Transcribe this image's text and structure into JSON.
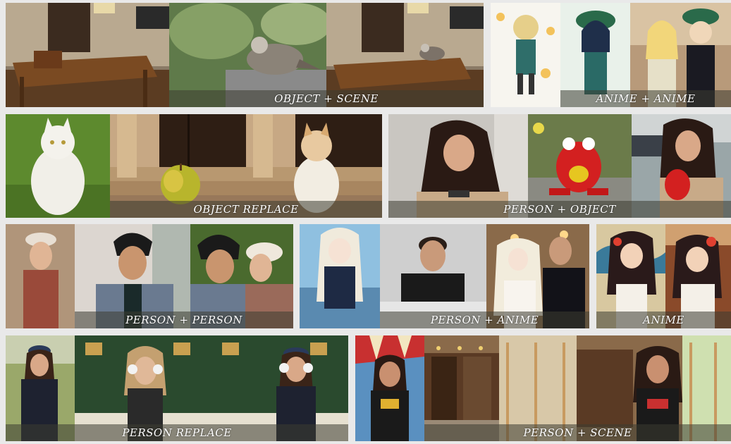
{
  "panels": {
    "object_scene": {
      "caption": "OBJECT + SCENE"
    },
    "anime_anime": {
      "caption": "ANIME + ANIME"
    },
    "object_replace": {
      "caption": "OBJECT REPLACE"
    },
    "person_object": {
      "caption": "PERSON + OBJECT"
    },
    "person_person": {
      "caption": "PERSON + PERSON"
    },
    "person_anime": {
      "caption": "PERSON + ANIME"
    },
    "anime": {
      "caption": "ANIME"
    },
    "person_replace": {
      "caption": "PERSON REPLACE"
    },
    "person_scene": {
      "caption": "PERSON + SCENE"
    }
  },
  "colors": {
    "background": "#e9e9e9",
    "caption_bg": "#3c3c32",
    "caption_text": "#ffffff"
  }
}
